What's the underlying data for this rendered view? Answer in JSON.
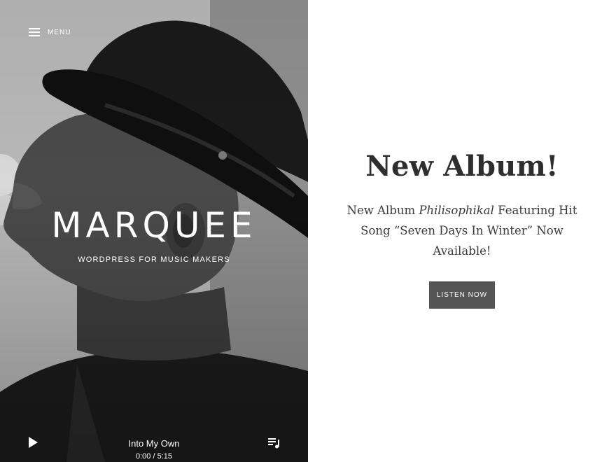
{
  "nav": {
    "menu_label": "MENU"
  },
  "hero": {
    "title": "MARQUEE",
    "tagline": "WORDPRESS FOR MUSIC MAKERS",
    "image_alt": "Black and white portrait of a man in a hat"
  },
  "player": {
    "track_title": "Into My Own",
    "elapsed": "0:00",
    "duration": "5:15",
    "time_separator": " / "
  },
  "content": {
    "headline": "New Album!",
    "description_before": "New Album ",
    "description_emphasis": "Philisophikal",
    "description_after": " Featuring Hit Song “Seven Days In Winter” Now Available!",
    "cta_label": "LISTEN NOW"
  },
  "icons": {
    "menu": "hamburger-icon",
    "play": "play-icon",
    "playlist": "playlist-icon"
  },
  "colors": {
    "accent_button": "#555555",
    "headline": "#2e2e2e",
    "body_text": "#3a3a3a"
  }
}
